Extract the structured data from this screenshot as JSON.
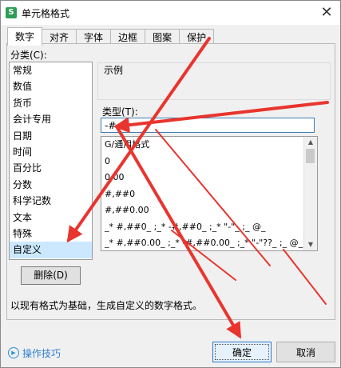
{
  "window": {
    "title": "单元格格式",
    "app_icon_glyph": "S",
    "close_glyph": "✕"
  },
  "tabs": [
    {
      "label": "数字",
      "active": true
    },
    {
      "label": "对齐"
    },
    {
      "label": "字体"
    },
    {
      "label": "边框"
    },
    {
      "label": "图案"
    },
    {
      "label": "保护"
    }
  ],
  "category": {
    "label": "分类(C):",
    "items": [
      "常规",
      "数值",
      "货币",
      "会计专用",
      "日期",
      "时间",
      "百分比",
      "分数",
      "科学记数",
      "文本",
      "特殊",
      "自定义"
    ],
    "selected": "自定义"
  },
  "delete_button": "删除(D)",
  "sample": {
    "label": "示例",
    "value": ""
  },
  "type": {
    "label": "类型(T):",
    "value": "-#",
    "list": [
      "G/通用格式",
      "0",
      "0.00",
      "#,##0",
      "#,##0.00",
      "_* #,##0_ ;_* -#,##0_ ;_* \"-\"_ ;_ @_",
      "_* #,##0.00_ ;_* -#,##0.00_ ;_* \"-\"??_ ;_ @_"
    ]
  },
  "description": "以现有格式为基础，生成自定义的数字格式。",
  "footer": {
    "tips_link": "操作技巧",
    "ok": "确定",
    "cancel": "取消"
  },
  "colors": {
    "accent": "#2e7bd6",
    "selection": "#cce8ff",
    "annotation_arrow": "#e8352e",
    "link": "#2f7fd0"
  }
}
